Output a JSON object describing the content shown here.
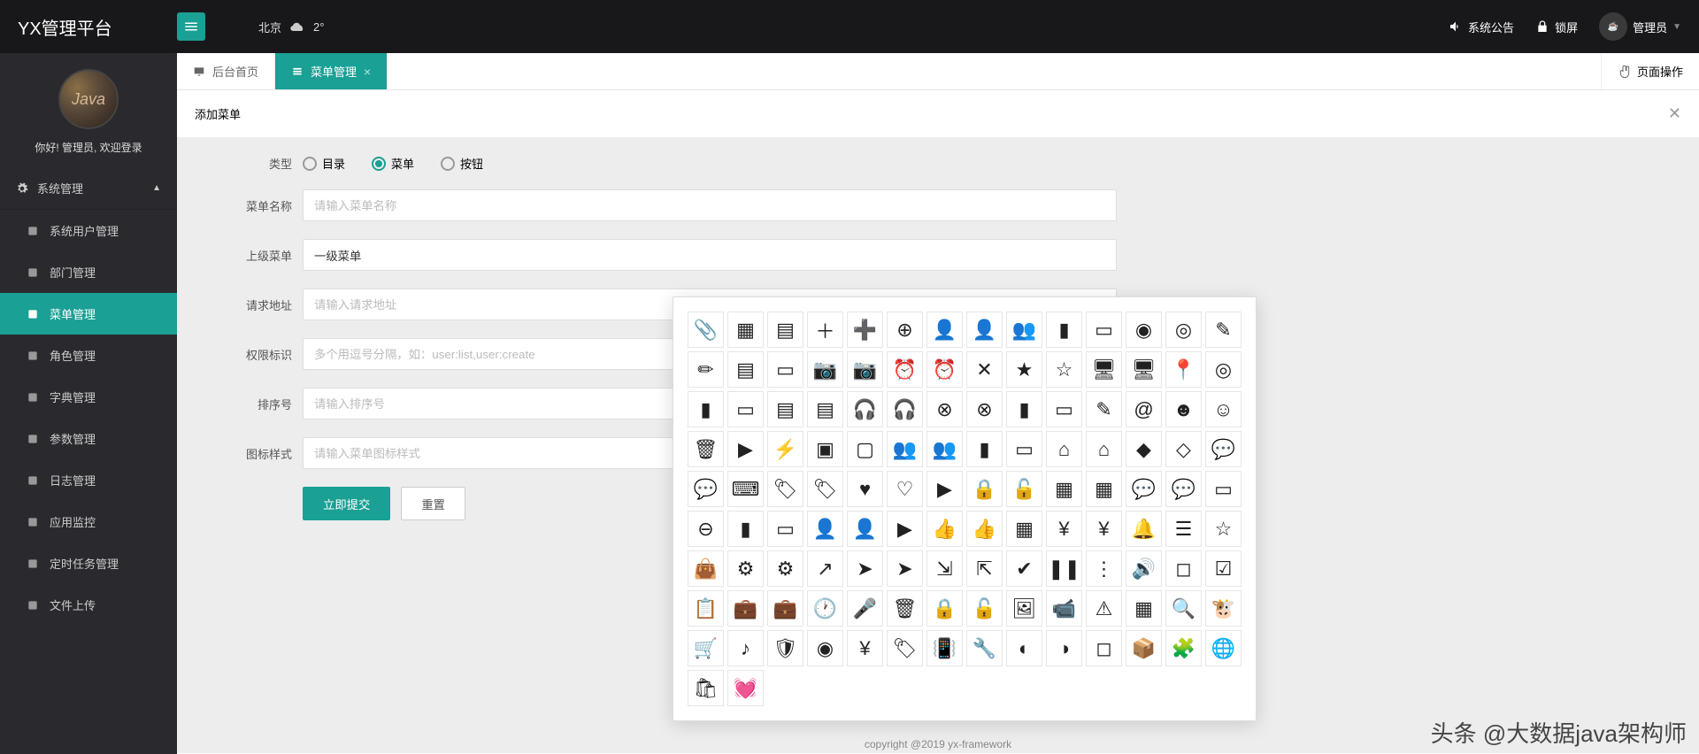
{
  "header": {
    "logo": "YX管理平台",
    "weather_city": "北京",
    "weather_temp": "2°",
    "notice": "系统公告",
    "lock": "锁屏",
    "user": "管理员"
  },
  "sidebar": {
    "greeting": "你好! 管理员, 欢迎登录",
    "group": "系统管理",
    "items": [
      {
        "label": "系统用户管理",
        "icon": "users"
      },
      {
        "label": "部门管理",
        "icon": "sitemap"
      },
      {
        "label": "菜单管理",
        "icon": "list",
        "active": true
      },
      {
        "label": "角色管理",
        "icon": "key"
      },
      {
        "label": "字典管理",
        "icon": "book"
      },
      {
        "label": "参数管理",
        "icon": "layers"
      },
      {
        "label": "日志管理",
        "icon": "file"
      },
      {
        "label": "应用监控",
        "icon": "monitor"
      },
      {
        "label": "定时任务管理",
        "icon": "clock"
      },
      {
        "label": "文件上传",
        "icon": "upload"
      }
    ]
  },
  "tabs": {
    "home": "后台首页",
    "current": "菜单管理",
    "page_ops": "页面操作"
  },
  "panel": {
    "title": "添加菜单"
  },
  "form": {
    "type_label": "类型",
    "type_opts": [
      "目录",
      "菜单",
      "按钮"
    ],
    "type_selected": 1,
    "name_label": "菜单名称",
    "name_ph": "请输入菜单名称",
    "parent_label": "上级菜单",
    "parent_val": "一级菜单",
    "url_label": "请求地址",
    "url_ph": "请输入请求地址",
    "perm_label": "权限标识",
    "perm_ph": "多个用逗号分隔，如：user:list,user:create",
    "sort_label": "排序号",
    "sort_ph": "请输入排序号",
    "icon_label": "图标样式",
    "icon_ph": "请输入菜单图标样式",
    "submit": "立即提交",
    "reset": "重置"
  },
  "footer": "copyright @2019 yx-framework",
  "watermark": "头条 @大数据java架构师",
  "icon_picker": [
    "attach",
    "calendar",
    "date",
    "plus",
    "plus-circle-fill",
    "plus-circle",
    "user-add-fill",
    "user-add",
    "users-fill",
    "card-fill",
    "card",
    "eye-fill",
    "eye",
    "edit",
    "edit-fill",
    "list-fill",
    "badge",
    "camera-fill",
    "camera",
    "alarm-fill",
    "alarm",
    "close",
    "star-fill",
    "star",
    "desktop-fill",
    "desktop",
    "location",
    "location-o",
    "coupon-fill",
    "coupon",
    "text-fill",
    "text",
    "headset-fill",
    "headset",
    "error-fill",
    "error",
    "note-fill",
    "note",
    "write",
    "at",
    "smile-fill",
    "smile",
    "trash",
    "next",
    "bolt",
    "crop-fill",
    "crop",
    "group-fill",
    "group",
    "id-fill",
    "id",
    "home-fill",
    "home",
    "diamond-fill",
    "diamond",
    "chat-dots-fill",
    "chat-dots",
    "keyboard",
    "tag-fill",
    "tag",
    "heart-fill",
    "heart",
    "tv",
    "lock-fill",
    "lock",
    "app-fill",
    "app",
    "chat-fill",
    "chat",
    "tablet",
    "minus-circle",
    "doc-fill",
    "doc",
    "user-fill",
    "user",
    "play",
    "thumb-fill",
    "thumb",
    "qr",
    "money-fill",
    "money",
    "bell",
    "bars",
    "bookmark",
    "bag",
    "gear-fill",
    "gear",
    "share",
    "send-fill",
    "send",
    "shrink",
    "expand",
    "check-fill",
    "pause",
    "more",
    "sound",
    "crop-tool",
    "check-box",
    "clipboard",
    "briefcase-fill",
    "briefcase",
    "clock",
    "mic",
    "trash-o",
    "lock-closed",
    "lock-open",
    "image",
    "video",
    "warn",
    "layout",
    "search",
    "bull",
    "cart",
    "music",
    "shield",
    "target",
    "yen",
    "tag-solid",
    "phone-vibrate",
    "wrench",
    "mask-fill",
    "mask",
    "box-o",
    "box",
    "puzzle",
    "globe",
    "shop",
    "heartbeat"
  ]
}
